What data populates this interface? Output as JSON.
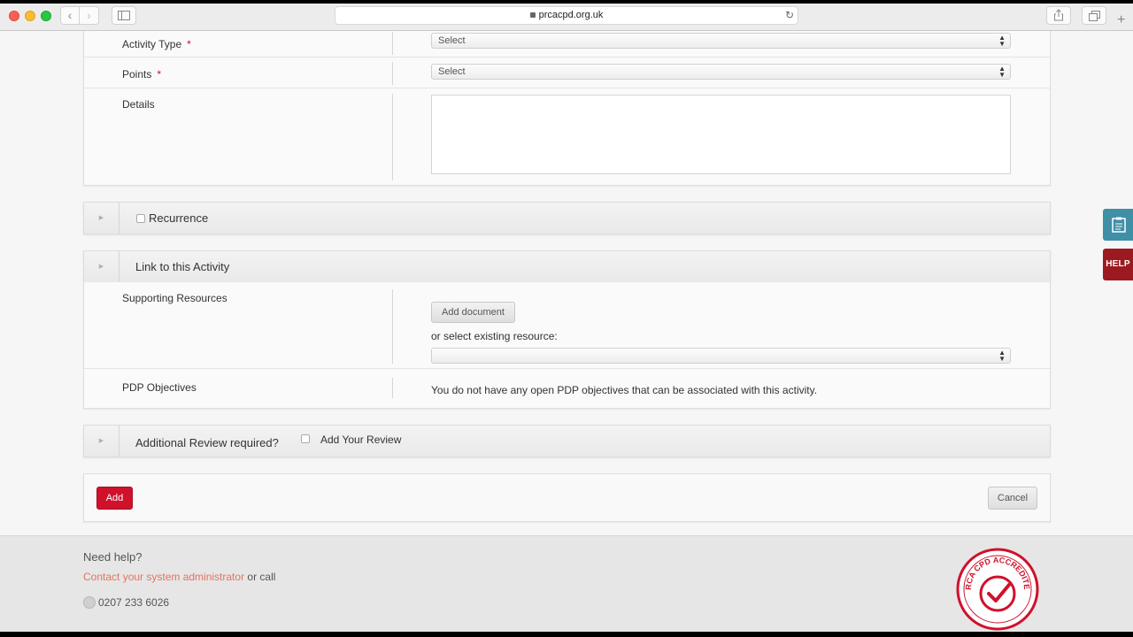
{
  "browser": {
    "url": "prcacpd.org.uk",
    "nav_back": "‹",
    "nav_forward": "›",
    "reload_icon": "↻",
    "new_tab": "+"
  },
  "form": {
    "activity_type": {
      "label": "Activity Type",
      "required_mark": "*",
      "select_value": "Select"
    },
    "points": {
      "label": "Points",
      "required_mark": "*",
      "select_value": "Select"
    },
    "details": {
      "label": "Details",
      "value": ""
    }
  },
  "recurrence": {
    "title": "Recurrence",
    "checked": false
  },
  "link_section": {
    "title": "Link to this Activity",
    "supporting_resources": {
      "label": "Supporting Resources",
      "add_document": "Add document",
      "existing_label": "or select existing resource:",
      "select_value": ""
    },
    "pdp_objectives": {
      "label": "PDP Objectives",
      "message": "You do not have any open PDP objectives that can be associated with this activity."
    }
  },
  "review_section": {
    "title": "Additional Review required?",
    "checkbox_label": "Add Your Review",
    "checked": false
  },
  "actions": {
    "add": "Add",
    "cancel": "Cancel"
  },
  "side_tabs": {
    "notes_icon": "clipboard-icon",
    "help": "HELP"
  },
  "footer": {
    "title": "Need help?",
    "contact_link": "Contact your system administrator",
    "contact_suffix": " or call",
    "phone": "0207 233 6026",
    "badge_text": "PRCA CPD ACCREDITED"
  },
  "colors": {
    "brand_red": "#d0112b",
    "help_red": "#9c1a1f",
    "notes_teal": "#3f8fa7",
    "link": "#e3735f"
  }
}
